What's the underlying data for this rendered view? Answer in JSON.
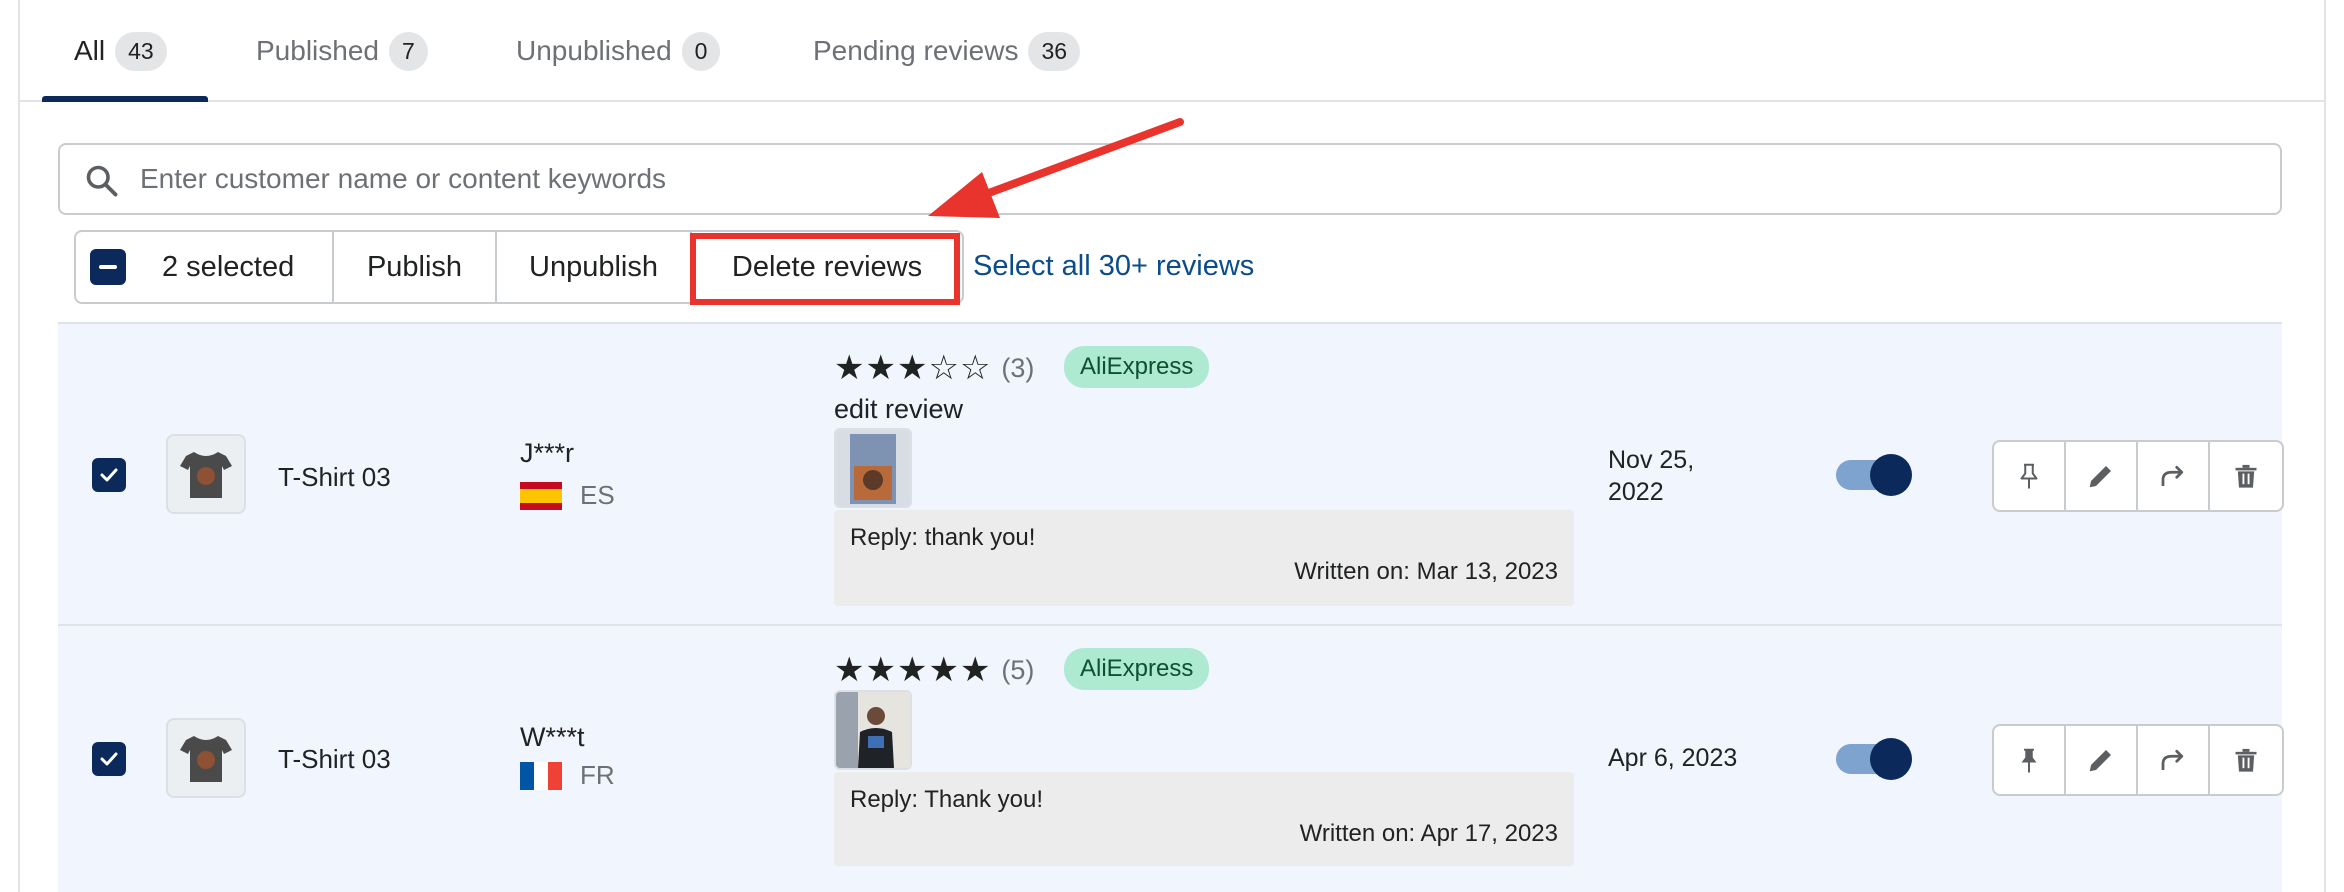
{
  "tabs": [
    {
      "label": "All",
      "count": "43"
    },
    {
      "label": "Published",
      "count": "7"
    },
    {
      "label": "Unpublished",
      "count": "0"
    },
    {
      "label": "Pending reviews",
      "count": "36"
    }
  ],
  "search": {
    "placeholder": "Enter customer name or content keywords",
    "value": ""
  },
  "bulk": {
    "selected_label": "2 selected",
    "publish_label": "Publish",
    "unpublish_label": "Unpublish",
    "delete_label": "Delete reviews",
    "select_all_label": "Select all 30+ reviews"
  },
  "colors": {
    "accent": "#0b2a5b",
    "highlight": "#e8342c",
    "badge_bg": "#aee9d1",
    "row_bg": "#f1f5fd"
  },
  "reviews": [
    {
      "checked": true,
      "product": "T-Shirt 03",
      "customer": "J***r",
      "country_code": "ES",
      "flag": "spain-flag-icon",
      "rating": "(3)",
      "stars": 3,
      "source": "AliExpress",
      "content": "edit review",
      "reply": "Reply: thank you!",
      "reply_written": "Written on: Mar 13, 2023",
      "date_line1": "Nov 25,",
      "date_line2": "2022",
      "published": true,
      "pinned": false
    },
    {
      "checked": true,
      "product": "T-Shirt 03",
      "customer": "W***t",
      "country_code": "FR",
      "flag": "france-flag-icon",
      "rating": "(5)",
      "stars": 5,
      "source": "AliExpress",
      "content": "",
      "reply": "Reply: Thank you!",
      "reply_written": "Written on: Apr 17, 2023",
      "date_line1": "Apr 6, 2023",
      "date_line2": "",
      "published": true,
      "pinned": true
    }
  ]
}
